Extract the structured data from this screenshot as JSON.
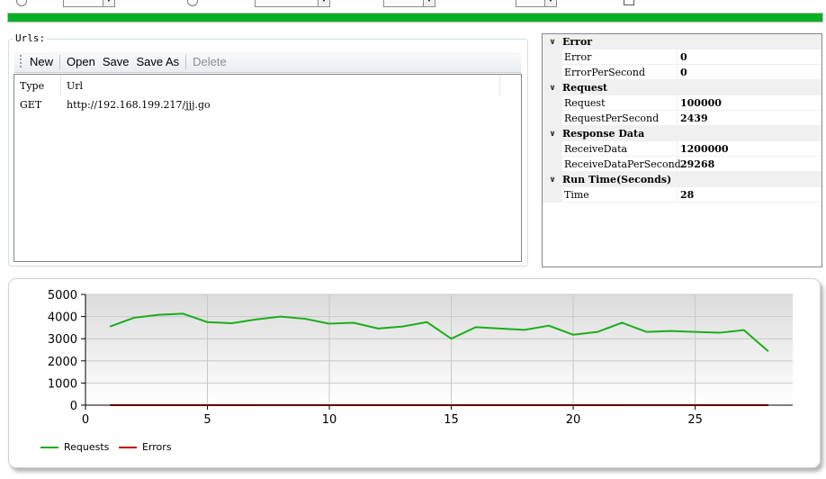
{
  "colors": {
    "accent_green": "#06b025",
    "requests_line": "#1aaf1a",
    "errors_line": "#c00000"
  },
  "progress": {
    "fraction": 1.0
  },
  "urls": {
    "legend": "Urls:",
    "toolbar": {
      "new": "New",
      "open": "Open",
      "save": "Save",
      "save_as": "Save As",
      "delete": "Delete"
    },
    "columns": [
      "Type",
      "Url"
    ],
    "rows": [
      {
        "type": "GET",
        "url": "http://192.168.199.217/jjj.go"
      }
    ]
  },
  "properties": {
    "categories": [
      {
        "name": "Error",
        "items": [
          {
            "name": "Error",
            "value": "0"
          },
          {
            "name": "ErrorPerSecond",
            "value": "0"
          }
        ]
      },
      {
        "name": "Request",
        "items": [
          {
            "name": "Request",
            "value": "100000"
          },
          {
            "name": "RequestPerSecond",
            "value": "2439"
          }
        ]
      },
      {
        "name": "Response Data",
        "items": [
          {
            "name": "ReceiveData",
            "value": "1200000"
          },
          {
            "name": "ReceiveDataPerSecond",
            "value": "29268"
          }
        ]
      },
      {
        "name": "Run Time(Seconds)",
        "items": [
          {
            "name": "Time",
            "value": "28"
          }
        ]
      }
    ]
  },
  "chart_data": {
    "type": "line",
    "xlim": [
      0,
      29
    ],
    "ylim": [
      0,
      5000
    ],
    "x_ticks": [
      "0",
      "5",
      "10",
      "15",
      "20",
      "25"
    ],
    "y_ticks": [
      "0",
      "1000",
      "2000",
      "3000",
      "4000",
      "5000"
    ],
    "grid": true,
    "legend": "bottom-left",
    "x": [
      1,
      2,
      3,
      4,
      5,
      6,
      7,
      8,
      9,
      10,
      11,
      12,
      13,
      14,
      15,
      16,
      17,
      18,
      19,
      20,
      21,
      22,
      23,
      24,
      25,
      26,
      27,
      28
    ],
    "series": [
      {
        "name": "Requests",
        "values": [
          3550,
          3950,
          4080,
          4130,
          3750,
          3700,
          3870,
          4000,
          3900,
          3680,
          3720,
          3460,
          3550,
          3750,
          3000,
          3520,
          3460,
          3400,
          3590,
          3180,
          3310,
          3720,
          3310,
          3350,
          3310,
          3270,
          3390,
          2430
        ]
      },
      {
        "name": "Errors",
        "values": [
          0,
          0,
          0,
          0,
          0,
          0,
          0,
          0,
          0,
          0,
          0,
          0,
          0,
          0,
          0,
          0,
          0,
          0,
          0,
          0,
          0,
          0,
          0,
          0,
          0,
          0,
          0,
          0
        ]
      }
    ]
  }
}
